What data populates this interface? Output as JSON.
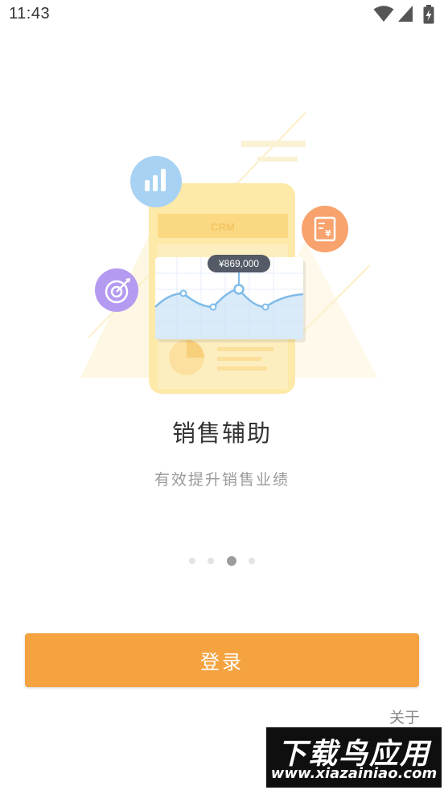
{
  "status_bar": {
    "time": "11:43",
    "icons": [
      "wifi-icon",
      "cell-signal-icon",
      "battery-charging-icon"
    ]
  },
  "illustration": {
    "phone_label": "CRM",
    "price_tag": "¥869,000",
    "badge_icons": [
      "bar-chart-icon",
      "target-icon",
      "invoice-yuan-icon"
    ],
    "colors": {
      "phone": "#fde9a8",
      "chart_line": "#7fbbe8",
      "tag": "#545a66"
    }
  },
  "slide": {
    "title": "销售辅助",
    "subtitle": "有效提升销售业绩",
    "page_count": 4,
    "active_page": 3
  },
  "login": {
    "label": "登录",
    "color": "#f4a340"
  },
  "about": {
    "label": "关于"
  },
  "watermark": {
    "main": "下载鸟应用",
    "sub": "www.xiazainiao.com"
  }
}
